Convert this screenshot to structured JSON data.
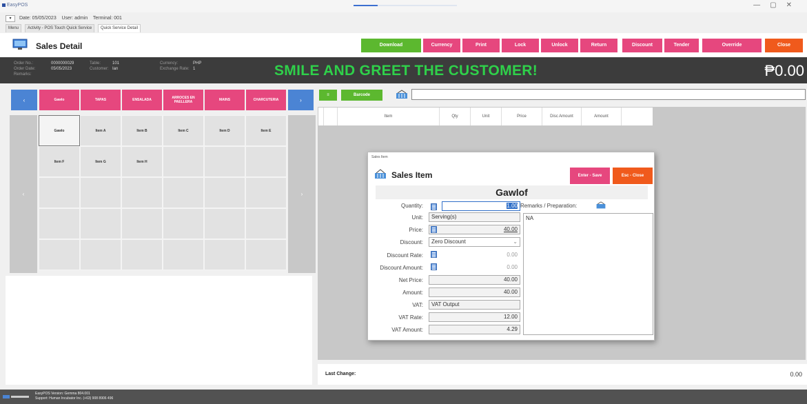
{
  "window": {
    "app_title": "EasyPOS"
  },
  "statusline": {
    "text": "Date: 05/05/2023    User: admin    Terminal: 001"
  },
  "tabs": [
    "Menu",
    "Activity - POS Touch Quick Service",
    "Quick Service Detail"
  ],
  "header": {
    "title": "Sales Detail",
    "buttons": [
      {
        "label": "Download",
        "color": "#5cb82f"
      },
      {
        "label": "Currency",
        "color": "#e6477e"
      },
      {
        "label": "Print",
        "color": "#e6477e"
      },
      {
        "label": "Lock",
        "color": "#e6477e"
      },
      {
        "label": "Unlock",
        "color": "#e6477e"
      },
      {
        "label": "Return",
        "color": "#e6477e"
      },
      {
        "label": "Discount",
        "color": "#e6477e"
      },
      {
        "label": "Tender",
        "color": "#e6477e"
      },
      {
        "label": "Override",
        "color": "#e6477e"
      },
      {
        "label": "Close",
        "color": "#f05a1c"
      }
    ]
  },
  "info": {
    "labels1": "Order No.:\nOrder Date:\nRemarks:",
    "values1": "0000000029\n05/05/2023",
    "labels2": "Table:\nCustomer:",
    "values2": "101\nIan",
    "labels3": "Currency:\nExchange Rate:",
    "values3": "PHP\n1",
    "greeting": "SMILE AND GREET THE CUSTOMER!",
    "total": "₱0.00"
  },
  "categories": [
    "Gawlo",
    "TAPAS",
    "ENSALADA",
    "ARROCES EN PAELLERA",
    "MAINS",
    "CHARCUTERIA"
  ],
  "items": [
    "Gawlo",
    "Item A",
    "Item B",
    "Item C",
    "Item D",
    "Item E",
    "Item F",
    "Item G",
    "Item H"
  ],
  "right": {
    "barcode_label": "Barcode",
    "columns": [
      "Item",
      "Qty",
      "Unit",
      "Price",
      "Disc Amount",
      "Amount"
    ],
    "last_change_label": "Last Change:",
    "last_change_value": "0.00"
  },
  "dialog": {
    "window_title": "Sales Item",
    "heading": "Sales Item",
    "save_button": "Enter - Save",
    "close_button": "Esc - Close",
    "item_name": "Gawlof",
    "labels": {
      "quantity": "Quantity:",
      "unit": "Unit:",
      "price": "Price:",
      "discount": "Discount:",
      "discount_rate": "Discount Rate:",
      "discount_amount": "Discount Amount:",
      "net_price": "Net Price:",
      "amount": "Amount:",
      "vat": "VAT:",
      "vat_rate": "VAT Rate:",
      "vat_amount": "VAT Amount:",
      "remarks": "Remarks / Preparation:"
    },
    "values": {
      "quantity": "1.00",
      "unit": "Serving(s)",
      "price": "40.00",
      "discount": "Zero Discount",
      "discount_rate": "0.00",
      "discount_amount": "0.00",
      "net_price": "40.00",
      "amount": "40.00",
      "vat": "VAT Output",
      "vat_rate": "12.00",
      "vat_amount": "4.29",
      "remarks": "NA"
    }
  },
  "footer": {
    "version": "EasyPOS Version: Gemma 804.001\nSupport: Human Incubator Inc. (+63) 908 8906 496"
  }
}
